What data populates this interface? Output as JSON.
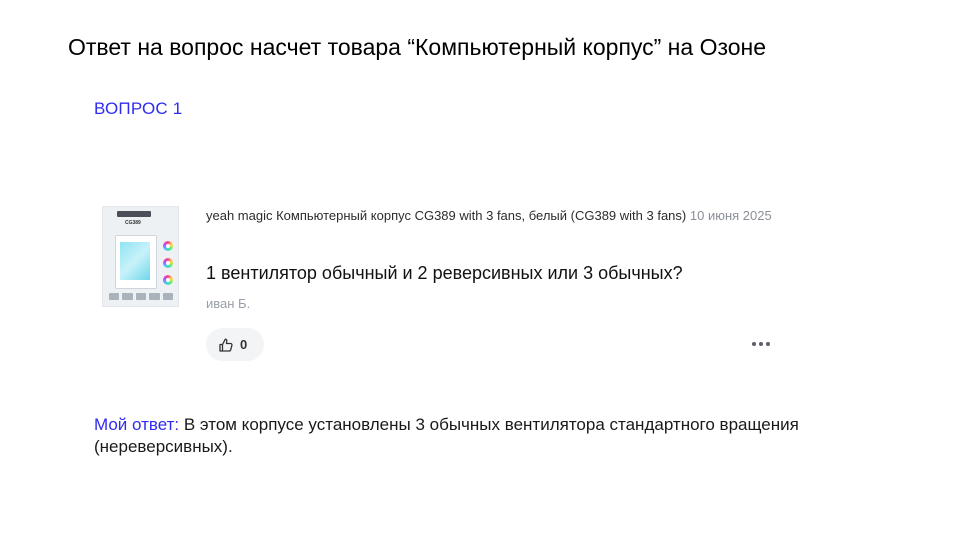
{
  "slide": {
    "title": "Ответ на вопрос насчет товара “Компьютерный корпус” на Озоне",
    "question_number": "ВОПРОС 1"
  },
  "review": {
    "thumbnail": {
      "model_text": "CG389"
    },
    "product_name": "yeah magic Компьютерный корпус CG389 with 3 fans, белый (CG389 with 3 fans)",
    "date": "10 июня 2025",
    "question": "1 вентилятор обычный и 2 реверсивных или 3 обычных?",
    "author": "иван Б.",
    "likes": "0",
    "icons": {
      "like": "thumbs-up-icon",
      "more": "more-dots-icon"
    }
  },
  "answer": {
    "label": "Мой ответ:",
    "text": " В этом корпусе установлены 3 обычных вентилятора стандартного вращения (нереверсивных)."
  },
  "colors": {
    "accent": "#2f2cf0",
    "muted": "#8a8f98",
    "pill": "#f3f4f6"
  }
}
